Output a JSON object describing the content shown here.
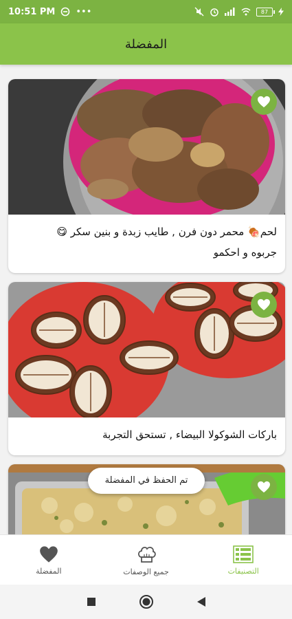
{
  "status_bar": {
    "time": "10:51 PM",
    "dots": "•••",
    "battery": "87"
  },
  "app_bar": {
    "title": "المفضلة"
  },
  "cards": [
    {
      "caption_line1": "لحم🍖 محمر دون فرن , طايب زبدة و بنين سكر 😋",
      "caption_line2": "جربوه و احكمو"
    },
    {
      "caption_line1": "باركات الشوكولا البيضاء , تستحق التجربة"
    }
  ],
  "toast": {
    "text": "تم الحفظ في المفضلة"
  },
  "bottom_nav": {
    "items": [
      {
        "label": "المفضلة",
        "icon": "heart-icon"
      },
      {
        "label": "جميع الوصفات",
        "icon": "chef-hat-icon"
      },
      {
        "label": "التصنيفات",
        "icon": "list-icon"
      }
    ],
    "active_color": "#8bc34a"
  },
  "colors": {
    "primary": "#8bc34a",
    "primary_dark": "#7cb342"
  }
}
